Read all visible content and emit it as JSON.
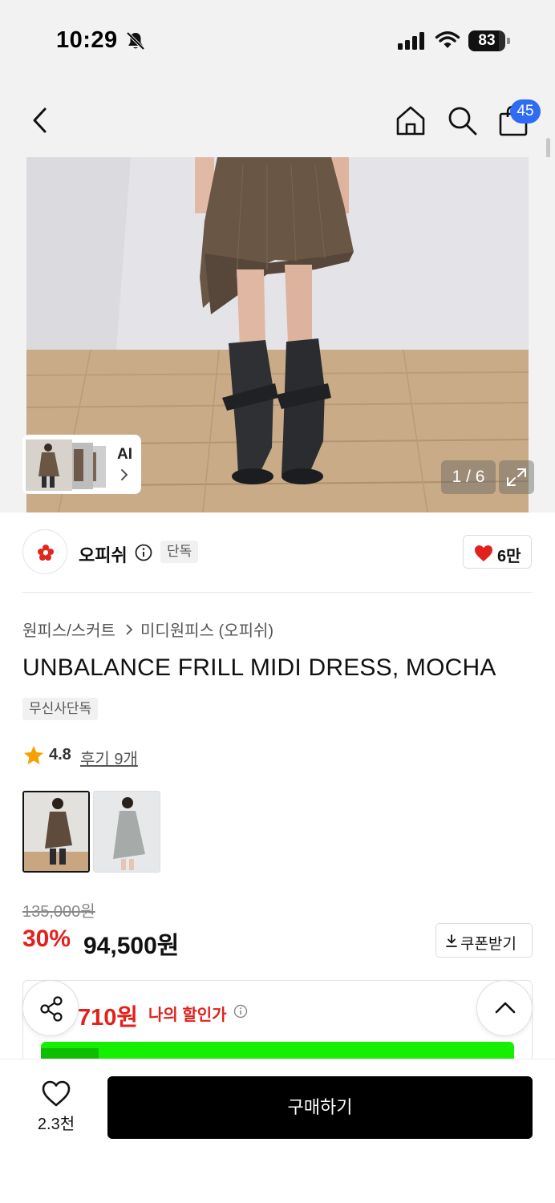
{
  "status_bar": {
    "time": "10:29",
    "battery": "83",
    "icons": [
      "bell-slash-icon",
      "cellular-signal-icon",
      "wifi-icon",
      "battery-icon"
    ]
  },
  "header": {
    "icons": [
      "back-chevron-icon",
      "home-icon",
      "search-icon",
      "shopping-bag-icon"
    ],
    "cart_count": "45"
  },
  "gallery": {
    "ai_label": "AI",
    "page_indicator": "1 / 6"
  },
  "brand": {
    "name": "오피쉬",
    "badge": "단독",
    "like_count": "6만"
  },
  "breadcrumb": {
    "category": "원피스/스커트",
    "subcategory": "미디원피스 (오피쉬)"
  },
  "product": {
    "title": "UNBALANCE FRILL MIDI DRESS, MOCHA",
    "badge": "무신사단독",
    "rating": "4.8",
    "review_link": "후기 9개"
  },
  "price": {
    "original": "135,000원",
    "discount_rate": "30%",
    "sale": "94,500원",
    "coupon_label": "쿠폰받기"
  },
  "my_discount": {
    "price": "710원",
    "label": "나의 할인가"
  },
  "bottom_bar": {
    "wish_count": "2.3천",
    "buy_label": "구매하기"
  },
  "colors": {
    "accent_red": "#e2211c",
    "badge_blue": "#2f6cf3",
    "promo_green": "#14f000"
  }
}
